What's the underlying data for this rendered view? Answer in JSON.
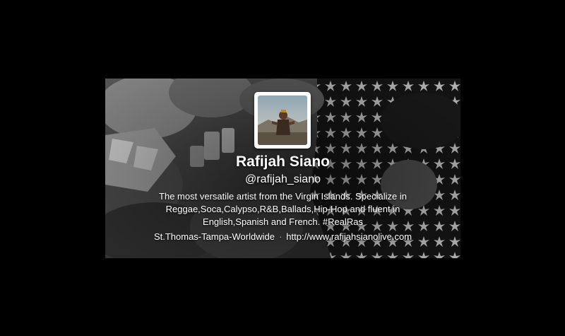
{
  "profile": {
    "name": "Rafijah Siano",
    "handle": "@rafijah_siano",
    "bio": "The most versatile artist from the Virgin Islands. Specialize in Reggae,Soca,Calypso,R&B,Ballads,Hip-Hop and fluent in English,Spanish and French. #RealRas",
    "location": "St.Thomas-Tampa-Worldwide",
    "separator": "·",
    "website": "http://www.rafijahsianolive.com"
  },
  "colors": {
    "page_background": "#000000",
    "text": "#ffffff",
    "avatar_frame": "#ffffff"
  }
}
